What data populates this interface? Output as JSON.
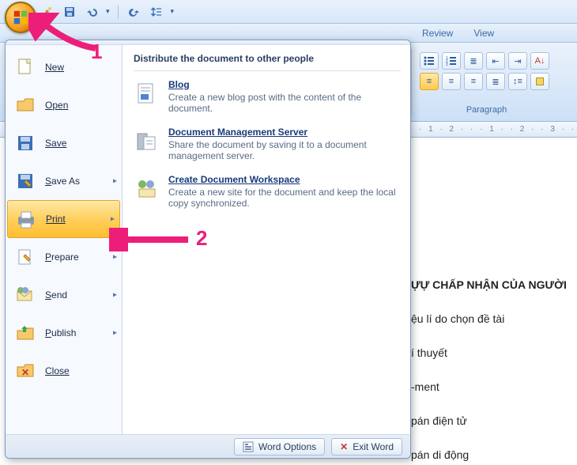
{
  "qat": {
    "brush": "brush-icon",
    "save": "save-icon",
    "undo": "undo-icon",
    "redo": "redo-icon",
    "spacing": "spacing-icon"
  },
  "tabs": {
    "review": "Review",
    "view": "View"
  },
  "ribbon": {
    "group_label": "Paragraph"
  },
  "ruler": "· 1 · 2 · · · 1 · · 2 · · 3 · · 4 · · 5 · ·",
  "office_menu": {
    "left": {
      "new": "New",
      "open": "Open",
      "save": "Save",
      "save_as": "Save As",
      "print": "Print",
      "prepare": "Prepare",
      "send": "Send",
      "publish": "Publish",
      "close": "Close"
    },
    "panel_title": "Distribute the document to other people",
    "sub": {
      "blog": {
        "title": "Blog",
        "desc": "Create a new blog post with the content of the document."
      },
      "dms": {
        "title": "Document Management Server",
        "desc": "Share the document by saving it to a document management server."
      },
      "cdw": {
        "title": "Create Document Workspace",
        "desc": "Create a new site for the document and keep the local copy synchronized."
      }
    },
    "footer": {
      "word_options": "Word Options",
      "exit_word": "Exit Word"
    }
  },
  "doc_lines": {
    "l1": "ỰỰ CHẤP NHẬN CỦA NGƯỜI",
    "l2": "ệu lí do chọn đề tài",
    "l3": "í thuyết",
    "l4": "-ment",
    "l5": "pán điện tử",
    "l6": "pán di động"
  },
  "callouts": {
    "one": "1",
    "two": "2"
  }
}
